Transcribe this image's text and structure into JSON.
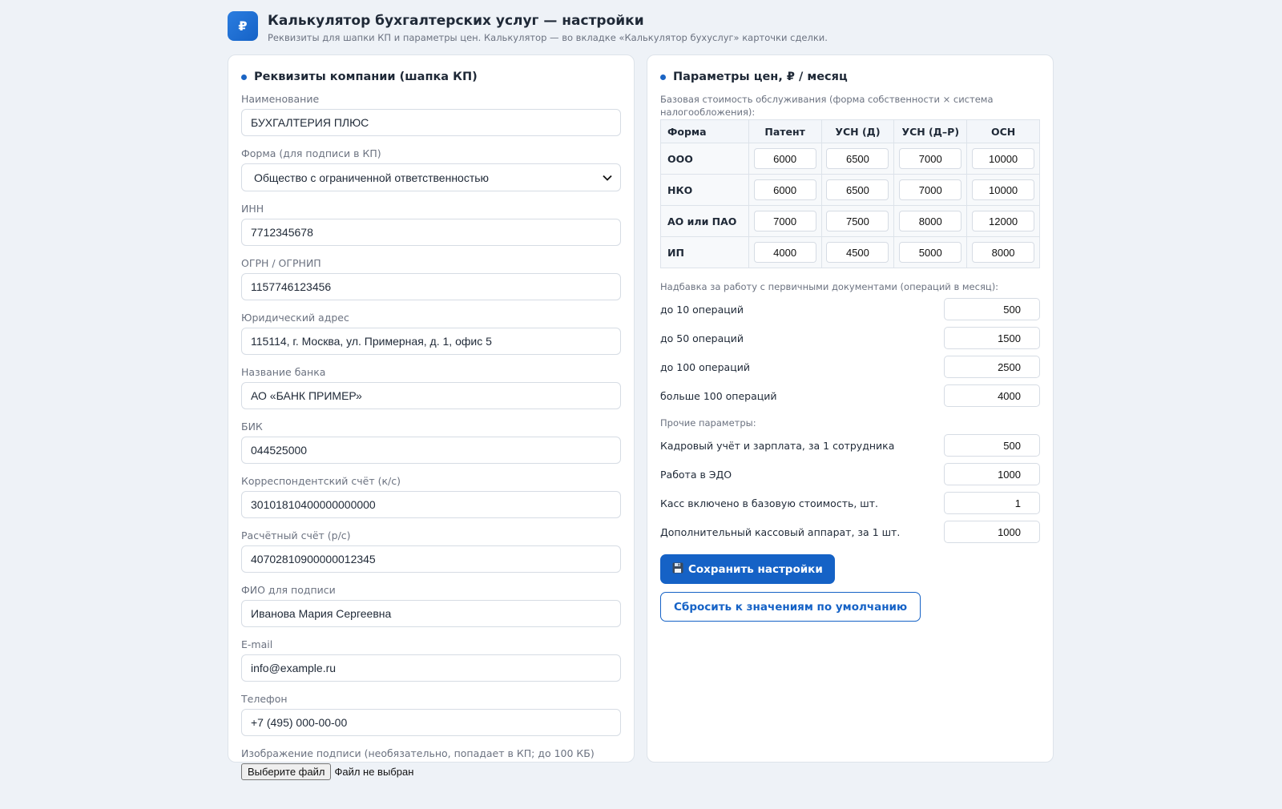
{
  "header": {
    "logo_glyph": "₽",
    "title": "Калькулятор бухгалтерских услуг — настройки",
    "subtitle": "Реквизиты для шапки КП и параметры цен. Калькулятор — во вкладке «Калькулятор бухуслуг» карточки сделки."
  },
  "company": {
    "title": "Реквизиты компании (шапка КП)",
    "name_label": "Наименование",
    "name_value": "БУХГАЛТЕРИЯ ПЛЮС",
    "form_label": "Форма (для подписи в КП)",
    "form_value": "Общество с ограниченной ответственностью",
    "inn_label": "ИНН",
    "inn_value": "7712345678",
    "ogrn_label": "ОГРН / ОГРНИП",
    "ogrn_value": "1157746123456",
    "address_label": "Юридический адрес",
    "address_value": "115114, г. Москва, ул. Примерная, д. 1, офис 5",
    "bank_label": "Название банка",
    "bank_value": "АО «БАНК ПРИМЕР»",
    "bik_label": "БИК",
    "bik_value": "044525000",
    "ks_label": "Корреспондентский счёт (к/с)",
    "ks_value": "30101810400000000000",
    "rs_label": "Расчётный счёт (р/с)",
    "rs_value": "40702810900000012345",
    "fio_label": "ФИО для подписи",
    "fio_value": "Иванова Мария Сергеевна",
    "email_label": "E-mail",
    "email_value": "info@example.ru",
    "phone_label": "Телефон",
    "phone_value": "+7 (495) 000-00-00",
    "signature_label": "Изображение подписи (необязательно, попадает в КП; до 100 КБ)",
    "file_button": "Выберите файл",
    "file_status": "Файл не выбран"
  },
  "pricing": {
    "title": "Параметры цен, ₽ / месяц",
    "base_note": "Базовая стоимость обслуживания (форма собственности × система налогообложения):",
    "columns": [
      "Форма",
      "Патент",
      "УСН (Д)",
      "УСН (Д–Р)",
      "ОСН"
    ],
    "rows": [
      {
        "form": "ООО",
        "values": [
          "6000",
          "6500",
          "7000",
          "10000"
        ]
      },
      {
        "form": "НКО",
        "values": [
          "6000",
          "6500",
          "7000",
          "10000"
        ]
      },
      {
        "form": "АО или ПАО",
        "values": [
          "7000",
          "7500",
          "8000",
          "12000"
        ]
      },
      {
        "form": "ИП",
        "values": [
          "4000",
          "4500",
          "5000",
          "8000"
        ]
      }
    ],
    "ops_note": "Надбавка за работу с первичными документами (операций в месяц):",
    "ops": [
      {
        "label": "до 10 операций",
        "value": "500"
      },
      {
        "label": "до 50 операций",
        "value": "1500"
      },
      {
        "label": "до 100 операций",
        "value": "2500"
      },
      {
        "label": "больше 100 операций",
        "value": "4000"
      }
    ],
    "other_note": "Прочие параметры:",
    "other": [
      {
        "label": "Кадровый учёт и зарплата, за 1 сотрудника",
        "value": "500"
      },
      {
        "label": "Работа в ЭДО",
        "value": "1000"
      },
      {
        "label": "Касс включено в базовую стоимость, шт.",
        "value": "1"
      },
      {
        "label": "Дополнительный кассовый аппарат, за 1 шт.",
        "value": "1000"
      }
    ],
    "save_icon": "floppy-disk-icon",
    "save_label": "Сохранить настройки",
    "reset_label": "Сбросить к значениям по умолчанию"
  }
}
